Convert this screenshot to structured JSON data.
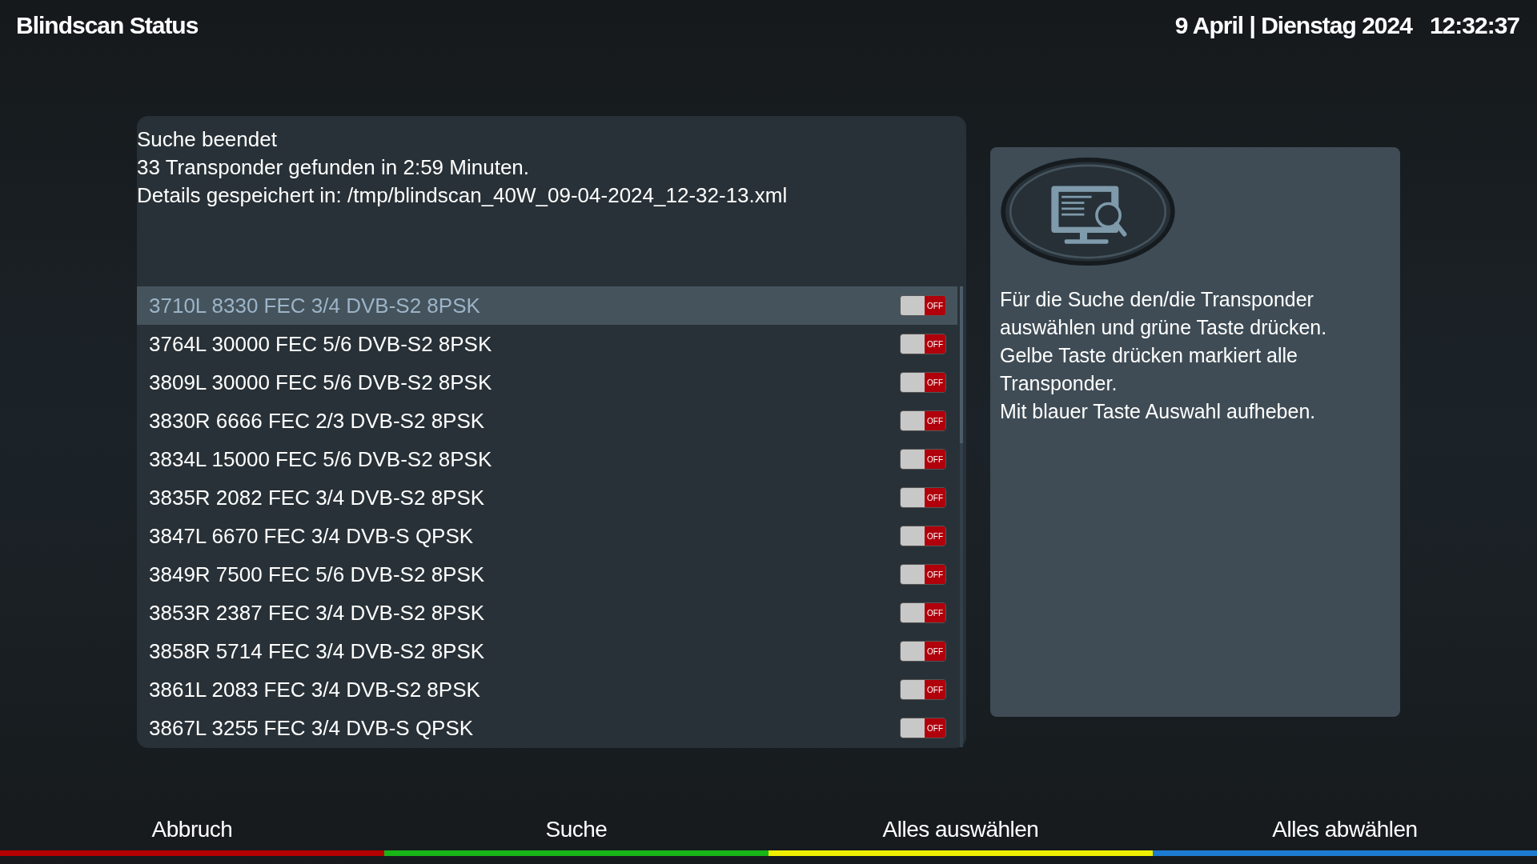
{
  "header": {
    "title": "Blindscan Status",
    "date": "9 April | Dienstag 2024",
    "time": "12:32:37"
  },
  "status": {
    "lines": [
      "Suche beendet",
      "33 Transponder gefunden in 2:59 Minuten.",
      "Details gespeichert in: /tmp/blindscan_40W_09-04-2024_12-32-13.xml"
    ]
  },
  "transponders": [
    {
      "label": "3710L 8330 FEC 3/4 DVB-S2 8PSK",
      "selected": true,
      "on": false,
      "toggle_text": "OFF"
    },
    {
      "label": "3764L 30000 FEC 5/6 DVB-S2 8PSK",
      "selected": false,
      "on": false,
      "toggle_text": "OFF"
    },
    {
      "label": "3809L 30000 FEC 5/6 DVB-S2 8PSK",
      "selected": false,
      "on": false,
      "toggle_text": "OFF"
    },
    {
      "label": "3830R 6666 FEC 2/3 DVB-S2 8PSK",
      "selected": false,
      "on": false,
      "toggle_text": "OFF"
    },
    {
      "label": "3834L 15000 FEC 5/6 DVB-S2 8PSK",
      "selected": false,
      "on": false,
      "toggle_text": "OFF"
    },
    {
      "label": "3835R 2082 FEC 3/4 DVB-S2 8PSK",
      "selected": false,
      "on": false,
      "toggle_text": "OFF"
    },
    {
      "label": "3847L 6670 FEC 3/4 DVB-S QPSK",
      "selected": false,
      "on": false,
      "toggle_text": "OFF"
    },
    {
      "label": "3849R 7500 FEC 5/6 DVB-S2 8PSK",
      "selected": false,
      "on": false,
      "toggle_text": "OFF"
    },
    {
      "label": "3853R 2387 FEC 3/4 DVB-S2 8PSK",
      "selected": false,
      "on": false,
      "toggle_text": "OFF"
    },
    {
      "label": "3858R 5714 FEC 3/4 DVB-S2 8PSK",
      "selected": false,
      "on": false,
      "toggle_text": "OFF"
    },
    {
      "label": "3861L 2083 FEC 3/4 DVB-S2 8PSK",
      "selected": false,
      "on": false,
      "toggle_text": "OFF"
    },
    {
      "label": "3867L 3255 FEC 3/4 DVB-S QPSK",
      "selected": false,
      "on": false,
      "toggle_text": "OFF"
    }
  ],
  "help": {
    "lines": [
      "Für die Suche den/die Transponder",
      "auswählen und grüne Taste drücken.",
      "Gelbe Taste drücken markiert alle",
      "Transponder.",
      "Mit blauer Taste Auswahl aufheben."
    ]
  },
  "buttons": [
    {
      "label": "Abbruch",
      "color": "#b40000"
    },
    {
      "label": "Suche",
      "color": "#18b418"
    },
    {
      "label": "Alles auswählen",
      "color": "#eef000"
    },
    {
      "label": "Alles abwählen",
      "color": "#1c7bd0"
    }
  ]
}
